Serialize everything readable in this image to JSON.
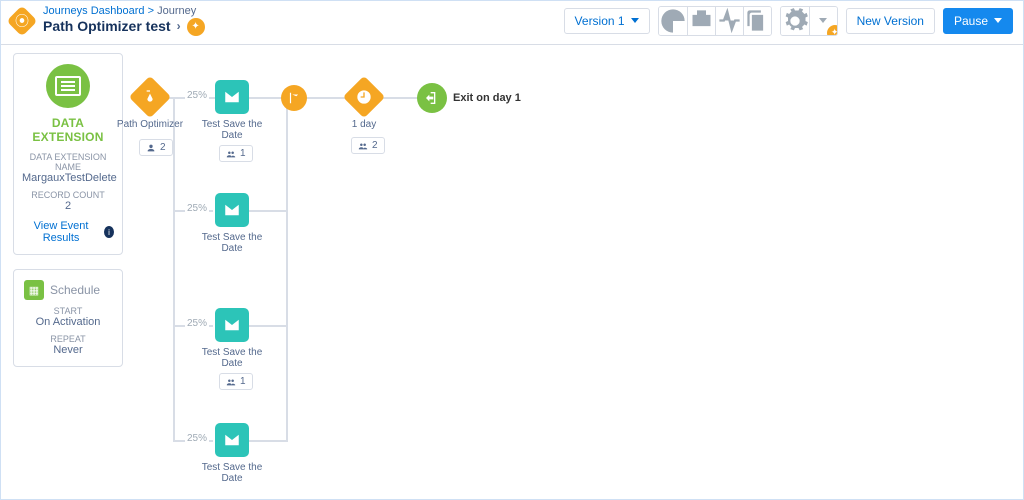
{
  "breadcrumb": {
    "dashboard": "Journeys Dashboard",
    "sep": ">",
    "journey": "Journey"
  },
  "title": "Path Optimizer test",
  "toolbar": {
    "version": "Version 1",
    "new_version": "New Version",
    "pause": "Pause"
  },
  "data_extension": {
    "heading": "DATA EXTENSION",
    "name_label": "DATA EXTENSION NAME",
    "name_value": "MargauxTestDelete",
    "count_label": "RECORD COUNT",
    "count_value": "2",
    "view_results": "View Event Results"
  },
  "schedule": {
    "heading": "Schedule",
    "start_label": "START",
    "start_value": "On Activation",
    "repeat_label": "REPEAT",
    "repeat_value": "Never"
  },
  "canvas": {
    "optimizer": {
      "label": "Path Optimizer",
      "count": "2"
    },
    "branches": [
      {
        "pct": "25%",
        "email_label": "Test Save the Date",
        "count": "1"
      },
      {
        "pct": "25%",
        "email_label": "Test Save the Date"
      },
      {
        "pct": "25%",
        "email_label": "Test Save the Date",
        "count": "1"
      },
      {
        "pct": "25%",
        "email_label": "Test Save the Date"
      }
    ],
    "wait": {
      "label": "1 day",
      "count": "2"
    },
    "exit": {
      "label": "Exit on day 1"
    }
  }
}
